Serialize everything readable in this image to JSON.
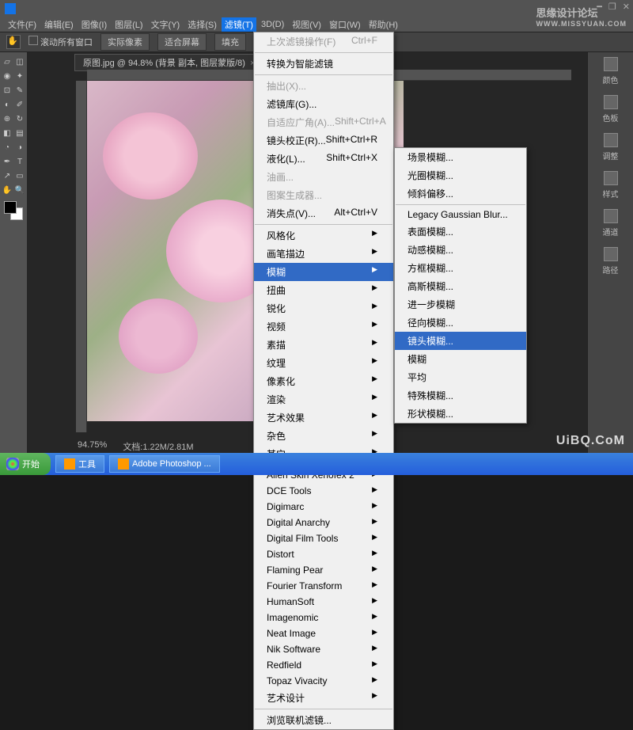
{
  "menubar": [
    "文件(F)",
    "编辑(E)",
    "图像(I)",
    "图层(L)",
    "文字(Y)",
    "选择(S)",
    "滤镜(T)",
    "3D(D)",
    "视图(V)",
    "窗口(W)",
    "帮助(H)"
  ],
  "menubar_active_index": 6,
  "optbar": {
    "scroll_all": "滚动所有窗口",
    "b1": "实际像素",
    "b2": "适合屏幕",
    "b3": "填充"
  },
  "doc_tab": "原图.jpg @ 94.8% (背景 副本, 图层蒙版/8)",
  "status": {
    "zoom": "94.75%",
    "size": "文档:1.22M/2.81M"
  },
  "right_panel": [
    "颜色",
    "色板",
    "调整",
    "样式",
    "通道",
    "路径"
  ],
  "dropdown1": {
    "top": [
      {
        "t": "上次滤镜操作(F)",
        "s": "Ctrl+F",
        "d": true
      }
    ],
    "smart": "转换为智能滤镜",
    "group1": [
      {
        "t": "抽出(X)...",
        "d": true
      },
      {
        "t": "滤镜库(G)...",
        "d": false
      },
      {
        "t": "自适应广角(A)...",
        "s": "Shift+Ctrl+A",
        "d": true
      },
      {
        "t": "镜头校正(R)...",
        "s": "Shift+Ctrl+R",
        "d": false
      },
      {
        "t": "液化(L)...",
        "s": "Shift+Ctrl+X",
        "d": false
      },
      {
        "t": "油画...",
        "d": true
      },
      {
        "t": "图案生成器...",
        "d": true
      },
      {
        "t": "消失点(V)...",
        "s": "Alt+Ctrl+V",
        "d": false
      }
    ],
    "group2": [
      {
        "t": "风格化",
        "a": true
      },
      {
        "t": "画笔描边",
        "a": true
      },
      {
        "t": "模糊",
        "a": true,
        "hl": true
      },
      {
        "t": "扭曲",
        "a": true
      },
      {
        "t": "锐化",
        "a": true
      },
      {
        "t": "视频",
        "a": true
      },
      {
        "t": "素描",
        "a": true
      },
      {
        "t": "纹理",
        "a": true
      },
      {
        "t": "像素化",
        "a": true
      },
      {
        "t": "渲染",
        "a": true
      },
      {
        "t": "艺术效果",
        "a": true
      },
      {
        "t": "杂色",
        "a": true
      },
      {
        "t": "其它",
        "a": true
      }
    ],
    "plugins": [
      "Alien Skin Xenofex 2",
      "DCE Tools",
      "Digimarc",
      "Digital Anarchy",
      "Digital Film Tools",
      "Distort",
      "Flaming Pear",
      "Fourier Transform",
      "HumanSoft",
      "Imagenomic",
      "Neat Image",
      "Nik Software",
      "Redfield",
      "Topaz Vivacity",
      "艺术设计"
    ],
    "bottom": "浏览联机滤镜..."
  },
  "dropdown2": {
    "top": [
      {
        "t": "场景模糊..."
      },
      {
        "t": "光圈模糊..."
      },
      {
        "t": "倾斜偏移..."
      }
    ],
    "main": [
      {
        "t": "Legacy Gaussian Blur..."
      },
      {
        "t": "表面模糊..."
      },
      {
        "t": "动感模糊..."
      },
      {
        "t": "方框模糊..."
      },
      {
        "t": "高斯模糊..."
      },
      {
        "t": "进一步模糊"
      },
      {
        "t": "径向模糊..."
      },
      {
        "t": "镜头模糊...",
        "hl": true
      },
      {
        "t": "模糊"
      },
      {
        "t": "平均"
      },
      {
        "t": "特殊模糊..."
      },
      {
        "t": "形状模糊..."
      }
    ]
  },
  "taskbar": {
    "start": "开始",
    "items": [
      "工具",
      "Adobe Photoshop ..."
    ]
  },
  "watermarks": {
    "w1a": "思缘设计论坛",
    "w1b": "WWW.MISSYUAN.COM",
    "w2": "UiBQ.CoM"
  }
}
